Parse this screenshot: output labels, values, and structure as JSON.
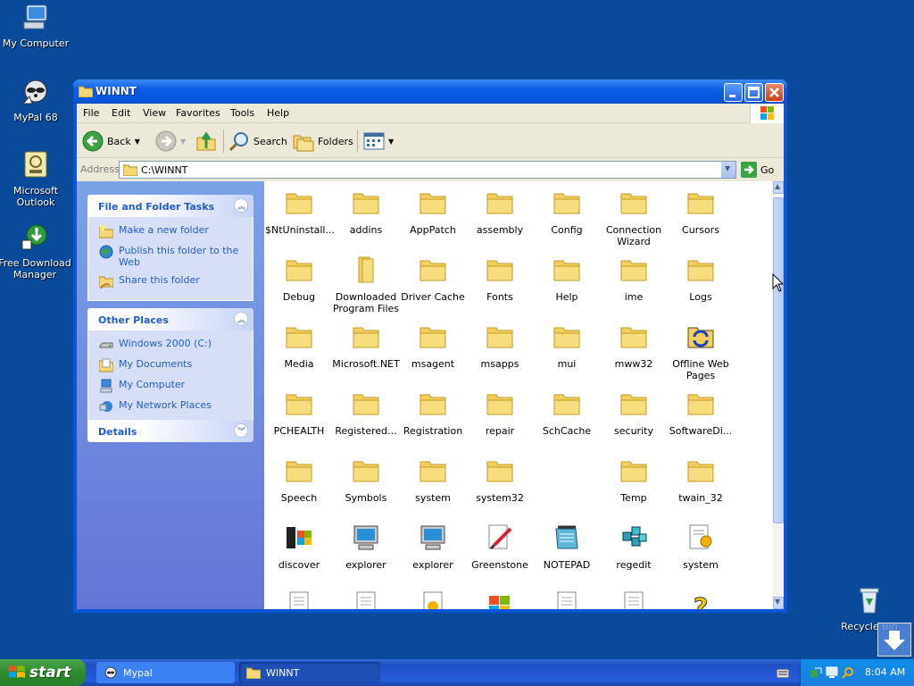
{
  "desktop": {
    "icons": [
      {
        "label": "My Computer"
      },
      {
        "label": "MyPal 68"
      },
      {
        "label": "Microsoft Outlook"
      },
      {
        "label": "Free Download Manager"
      },
      {
        "label": "Recycle Bin"
      }
    ]
  },
  "window": {
    "title": "WINNT",
    "menu": [
      "File",
      "Edit",
      "View",
      "Favorites",
      "Tools",
      "Help"
    ],
    "toolbar": {
      "back": "Back",
      "search": "Search",
      "folders": "Folders"
    },
    "address": {
      "label": "Address",
      "value": "C:\\WINNT",
      "go": "Go"
    },
    "left_panel": {
      "tasks": {
        "title": "File and Folder Tasks",
        "items": [
          "Make a new folder",
          "Publish this folder to the Web",
          "Share this folder"
        ]
      },
      "places": {
        "title": "Other Places",
        "items": [
          "Windows 2000 (C:)",
          "My Documents",
          "My Computer",
          "My Network Places"
        ]
      },
      "details": {
        "title": "Details"
      }
    },
    "files": [
      "$NtUninstall...",
      "addins",
      "AppPatch",
      "assembly",
      "Config",
      "Connection Wizard",
      "Cursors",
      "Debug",
      "Downloaded Program Files",
      "Driver Cache",
      "Fonts",
      "Help",
      "ime",
      "Logs",
      "Media",
      "Microsoft.NET",
      "msagent",
      "msapps",
      "mui",
      "mww32",
      "Offline Web Pages",
      "PCHEALTH",
      "Registered...",
      "Registration",
      "repair",
      "SchCache",
      "security",
      "SoftwareDi...",
      "Speech",
      "Symbols",
      "system",
      "system32",
      "Temp",
      "twain_32",
      "discover",
      "explorer",
      "explorer",
      "Greenstone",
      "NOTEPAD",
      "regedit",
      "system"
    ]
  },
  "taskbar": {
    "start": "start",
    "tasks": [
      "Mypal",
      "WINNT"
    ],
    "clock": "8:04 AM"
  }
}
